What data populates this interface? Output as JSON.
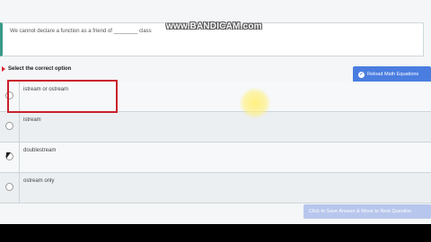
{
  "question": {
    "text": "We cannot declare a function as a friend of ________ class"
  },
  "watermark": "www.BANDICAM.com",
  "instruction": "Select the correct option",
  "reload_button": "Reload Math Equations",
  "options": [
    {
      "label": "istream or ostream"
    },
    {
      "label": "istream"
    },
    {
      "label": "doublestream"
    },
    {
      "label": "ostream only"
    }
  ],
  "submit_button": "Click to Save Answer & Move to Next Question",
  "colors": {
    "accent_blue": "#4a7de0",
    "highlight_red": "#c8202a",
    "question_border": "#3a9a8a"
  }
}
